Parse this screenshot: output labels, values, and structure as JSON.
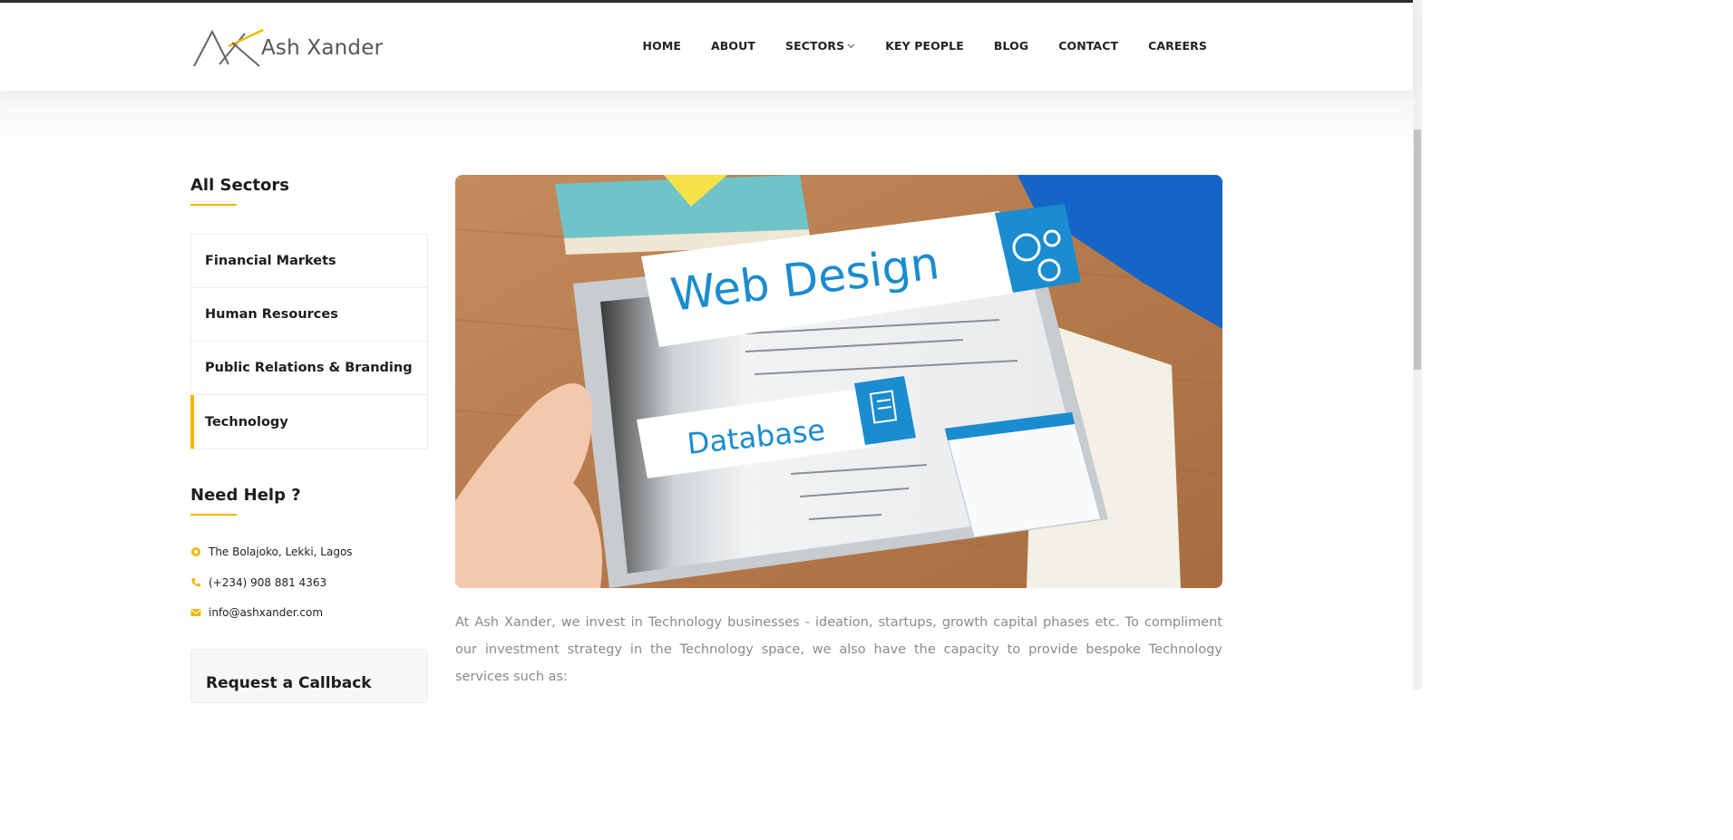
{
  "brand": {
    "name": "Ash Xander",
    "accent": "#f2b705",
    "text_color": "#222222"
  },
  "nav": {
    "items": [
      {
        "label": "HOME"
      },
      {
        "label": "ABOUT"
      },
      {
        "label": "SECTORS",
        "has_dropdown": true
      },
      {
        "label": "KEY PEOPLE"
      },
      {
        "label": "BLOG"
      },
      {
        "label": "CONTACT"
      },
      {
        "label": "CAREERS"
      }
    ]
  },
  "sidebar": {
    "sectors_title": "All Sectors",
    "sectors": [
      {
        "label": "Financial Markets",
        "active": false
      },
      {
        "label": "Human Resources",
        "active": false
      },
      {
        "label": "Public Relations & Branding",
        "active": false
      },
      {
        "label": "Technology",
        "active": true
      }
    ],
    "help_title": "Need Help ?",
    "contacts": [
      {
        "icon": "location-icon",
        "text": "The Bolajoko, Lekki, Lagos"
      },
      {
        "icon": "phone-icon",
        "text": "(+234) 908 881 4363"
      },
      {
        "icon": "email-icon",
        "text": "info@ashxander.com"
      }
    ],
    "callback_title": "Request a Callback"
  },
  "main": {
    "hero": {
      "banner_primary": "Web Design",
      "banner_secondary": "Database"
    },
    "intro": "At Ash Xander, we invest in Technology businesses - ideation, startups, growth capital phases etc. To compliment our investment strategy in the Technology space, we also have the capacity to provide bespoke Technology services such as:"
  }
}
